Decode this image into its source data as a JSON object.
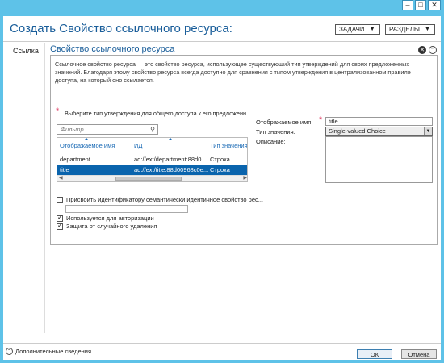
{
  "window": {
    "minimize_glyph": "–",
    "maximize_glyph": "□",
    "close_glyph": "✕"
  },
  "header": {
    "title": "Создать Свойство ссылочного ресурса:",
    "tasks_label": "ЗАДАЧИ",
    "sections_label": "РАЗДЕЛЫ"
  },
  "nav": {
    "items": [
      {
        "label": "Ссылка"
      }
    ]
  },
  "section": {
    "title": "Свойство ссылочного ресурса",
    "description": "Ссылочное свойство ресурса — это свойство ресурса, использующее существующий тип утверждений для своих предложенных значений. Благодаря этому свойство ресурса всегда доступно для сравнения с типом утверждения в централизованном правиле доступа, на который оно ссылается."
  },
  "picker": {
    "label": "Выберите тип утверждения для общего доступа к его предложенным значениям:",
    "filter_placeholder": "Фильтр",
    "columns": [
      "Отображаемое имя",
      "ИД",
      "Тип значения"
    ],
    "rows": [
      {
        "name": "department",
        "id": "ad://ext/department:88d0...",
        "type": "Строка",
        "selected": false
      },
      {
        "name": "title",
        "id": "ad://ext/title:88d00968c0e...",
        "type": "Строка",
        "selected": true
      }
    ]
  },
  "form": {
    "display_name_label": "Отображаемое имя:",
    "display_name_value": "title",
    "value_type_label": "Тип значения:",
    "value_type_value": "Single-valued Choice",
    "description_label": "Описание:",
    "description_value": ""
  },
  "options": {
    "assign_semantic_label": "Присвоить идентификатору семантически идентичное свойство рес...",
    "assign_semantic_checked": false,
    "used_for_auth_label": "Используется для авторизации",
    "used_for_auth_checked": true,
    "protect_delete_label": "Защита от случайного удаления",
    "protect_delete_checked": true
  },
  "footer": {
    "more_info_label": "Дополнительные сведения",
    "ok_label": "ОК",
    "cancel_label": "Отмена"
  },
  "colors": {
    "accent_blue": "#1a5e9a",
    "selection": "#0a64ad",
    "required_star": "#e0446a",
    "titlebar": "#5ec2e8"
  }
}
